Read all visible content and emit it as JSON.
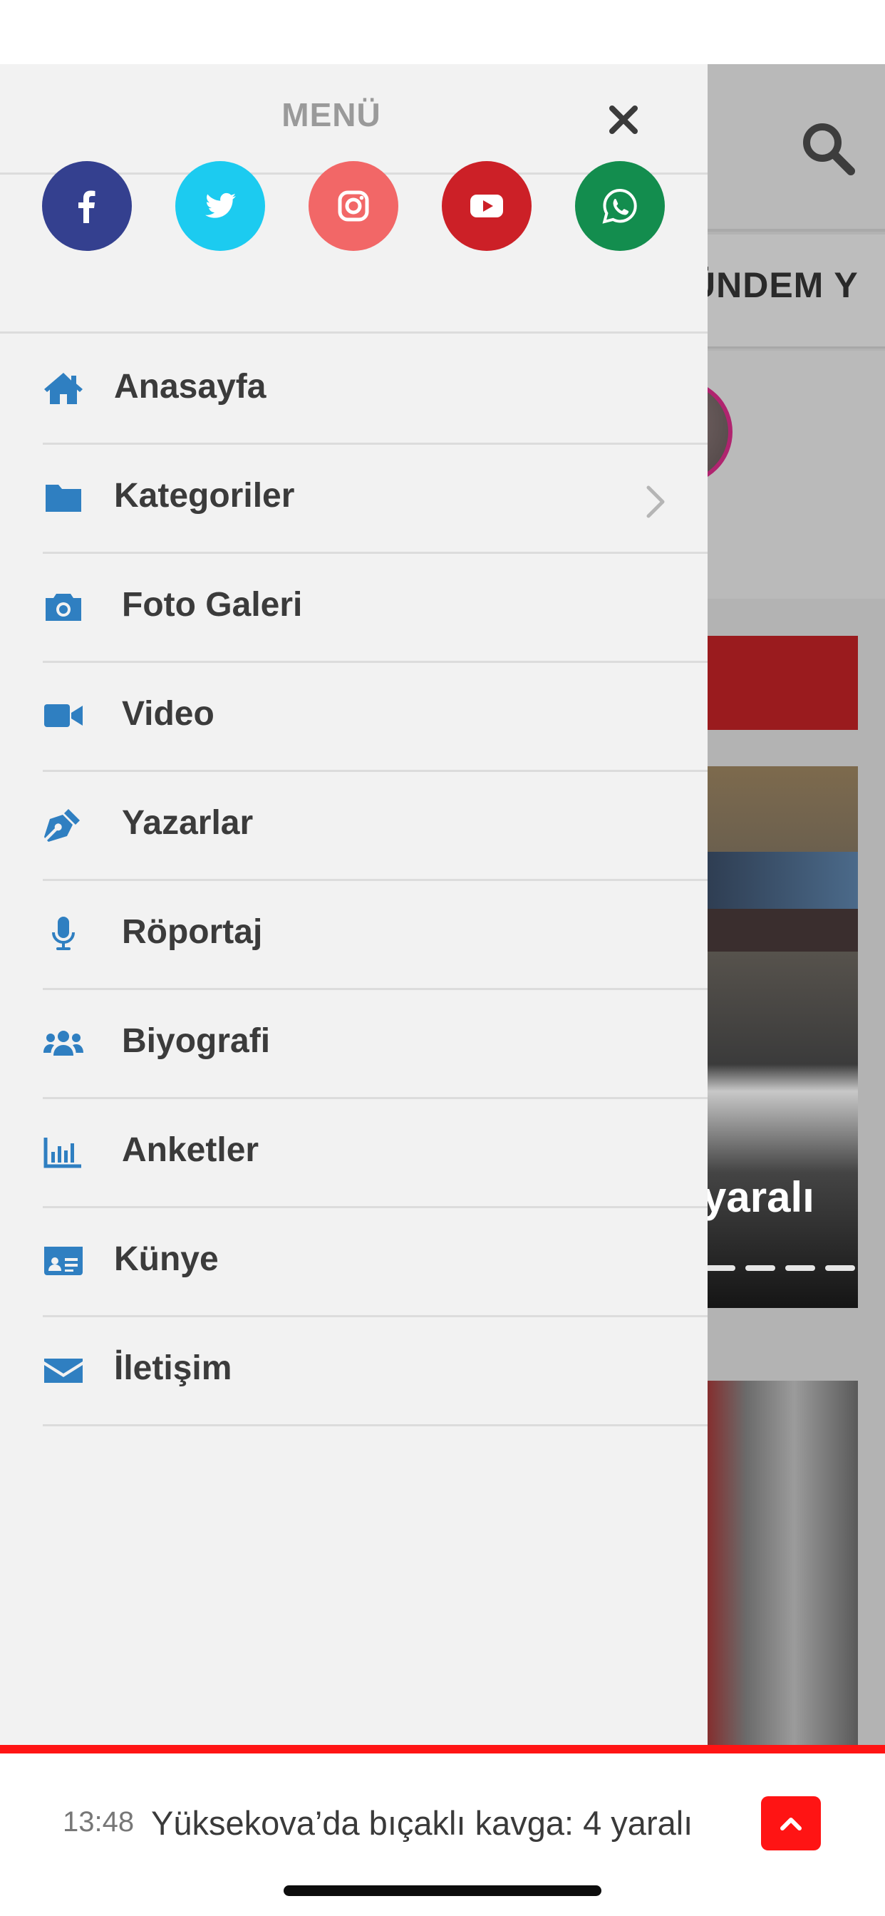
{
  "drawer": {
    "title": "MENÜ",
    "social": [
      {
        "name": "facebook",
        "color": "#34408f"
      },
      {
        "name": "twitter",
        "color": "#1ccbf0"
      },
      {
        "name": "instagram",
        "color": "#f26767"
      },
      {
        "name": "youtube",
        "color": "#cc2027"
      },
      {
        "name": "whatsapp",
        "color": "#138d4e"
      }
    ],
    "items": [
      {
        "label": "Anasayfa",
        "icon": "home-icon"
      },
      {
        "label": "Kategoriler",
        "icon": "folder-icon"
      },
      {
        "label": "Foto Galeri",
        "icon": "camera-icon"
      },
      {
        "label": "Video",
        "icon": "video-camera-icon"
      },
      {
        "label": "Yazarlar",
        "icon": "pen-icon"
      },
      {
        "label": "Röportaj",
        "icon": "microphone-icon"
      },
      {
        "label": "Biyografi",
        "icon": "users-icon"
      },
      {
        "label": "Anketler",
        "icon": "bar-chart-icon"
      },
      {
        "label": "Künye",
        "icon": "id-card-icon"
      },
      {
        "label": "İletişim",
        "icon": "envelope-icon"
      }
    ],
    "icon_color": "#2f7fc1"
  },
  "background": {
    "nav_text": "ÜNDEM  Y",
    "slide_caption": "yaralı"
  },
  "ticker": {
    "time": "13:48",
    "headline": "Yüksekova’da bıçaklı kavga: 4 yaralı",
    "accent": "#ff1414"
  }
}
